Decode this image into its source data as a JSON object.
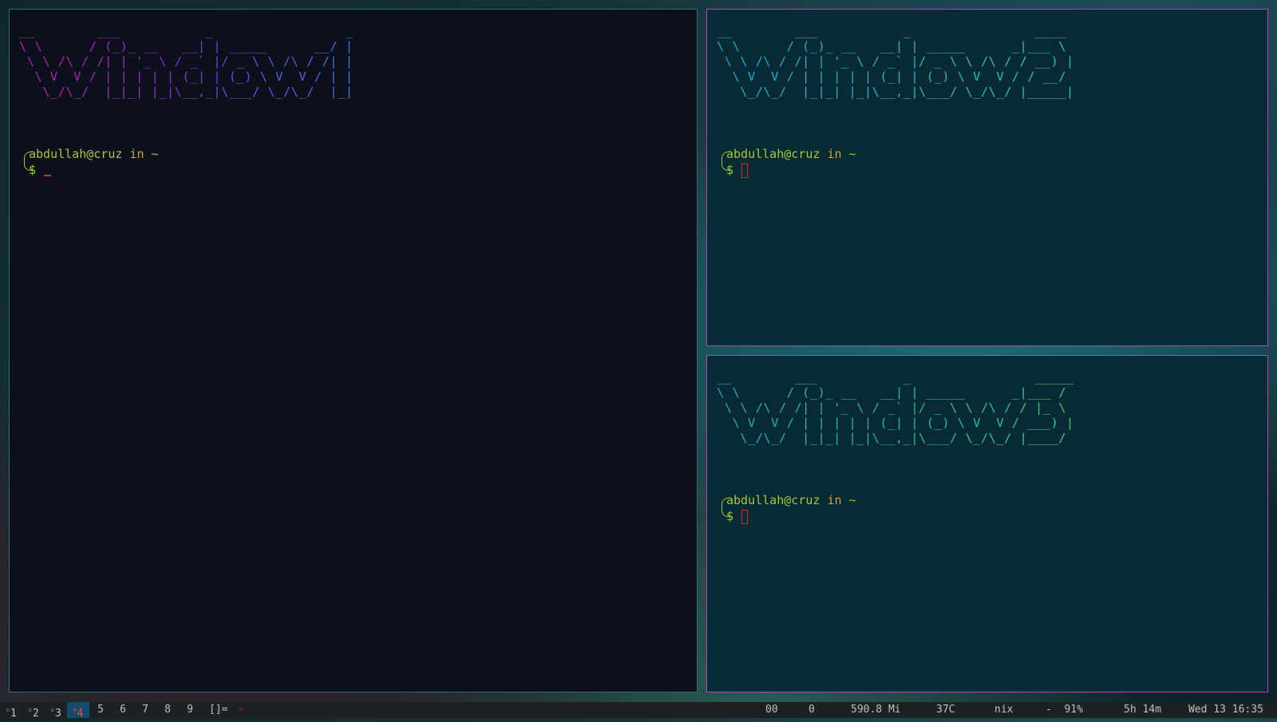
{
  "windows": [
    {
      "id": "window-1",
      "banner": "__        ___           _                 _ \n\\ \\      / (_)_ __   __| | _____      __/ |\n \\ \\ /\\ / /| | '_ \\ / _` |/ _ \\ \\ /\\ / /| |\n  \\ V  V / | | | | | (_| | (_) \\ V  V / | |\n   \\_/\\_/  |_|_| |_|\\__,_|\\___/ \\_/\\_/  |_|",
      "prompt_user": "abdullah@cruz",
      "prompt_in": "in",
      "prompt_dir": "~",
      "prompt_symbol": "$"
    },
    {
      "id": "window-2",
      "banner": "__        ___           _                ____  \n\\ \\      / (_)_ __   __| | _____      _|___ \\ \n \\ \\ /\\ / /| | '_ \\ / _` |/ _ \\ \\ /\\ / / __) |\n  \\ V  V / | | | | | (_| | (_) \\ V  V / / __/ \n   \\_/\\_/  |_|_| |_|\\__,_|\\___/ \\_/\\_/ |_____|",
      "prompt_user": "abdullah@cruz",
      "prompt_in": "in",
      "prompt_dir": "~",
      "prompt_symbol": "$"
    },
    {
      "id": "window-3",
      "banner": "__        ___           _                _____ \n\\ \\      / (_)_ __   __| | _____      _|___ / \n \\ \\ /\\ / /| | '_ \\ / _` |/ _ \\ \\ /\\ / / |_ \\ \n  \\ V  V / | | | | | (_| | (_) \\ V  V / ___) |\n   \\_/\\_/  |_|_| |_|\\__,_|\\___/ \\_/\\_/ |____/ ",
      "prompt_user": "abdullah@cruz",
      "prompt_in": "in",
      "prompt_dir": "~",
      "prompt_symbol": "$"
    }
  ],
  "bar": {
    "workspaces": [
      {
        "num": "1",
        "marker": "▫"
      },
      {
        "num": "2",
        "marker": "▫"
      },
      {
        "num": "3",
        "marker": "▫"
      },
      {
        "num": "4",
        "marker": "▪",
        "active": true
      },
      {
        "num": "5"
      },
      {
        "num": "6"
      },
      {
        "num": "7"
      },
      {
        "num": "8"
      },
      {
        "num": "9"
      }
    ],
    "layout": "[]=",
    "layout_marker": "▫",
    "stats": {
      "s1": "00",
      "s2": "0",
      "memory": "590.8 Mi",
      "temp": "37C",
      "os": "nix",
      "battery": "-  91%",
      "uptime": "5h 14m",
      "datetime": "Wed 13 16:35"
    }
  },
  "colors": {
    "terminal_bg_1": "#0c101b",
    "terminal_bg_2": "#082a35",
    "border_active": "#c23cc4",
    "prompt_green": "#a4c63a",
    "cursor_red": "#e02530",
    "bar_bg": "#1d2125",
    "active_ws": "#144b6b"
  }
}
